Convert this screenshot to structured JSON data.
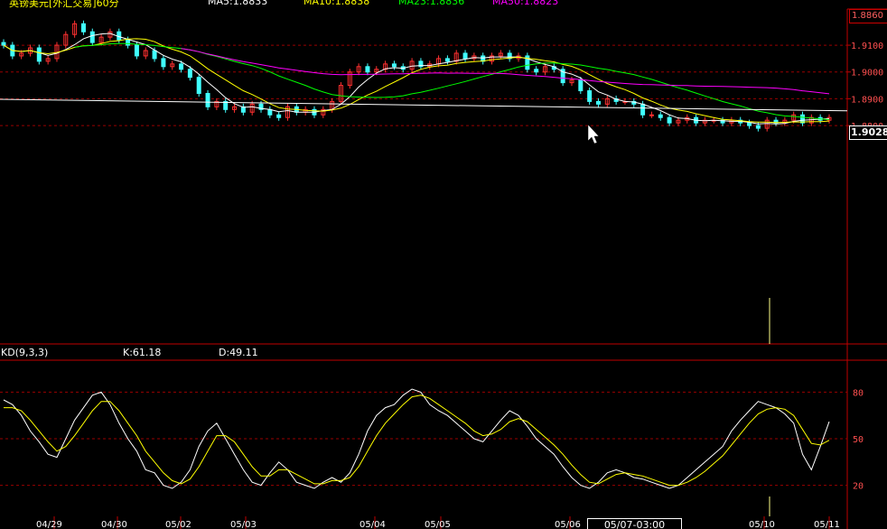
{
  "header": {
    "symbol_title": "英镑美元[外汇交易]60分",
    "ma5": "MA5:1.8833",
    "ma10": "MA10:1.8838",
    "ma23": "MA23:1.8836",
    "ma50": "MA50:1.8823"
  },
  "colors": {
    "background": "#000000",
    "up_candle": "#ff3030",
    "down_candle": "#40ffff",
    "ma5": "#ffffff",
    "ma10": "#ffff00",
    "ma23": "#00ff00",
    "ma50": "#ff00ff",
    "trendline": "#ffffff",
    "grid": "#990000"
  },
  "price_panel": {
    "top_value": "1.8860",
    "cursor_value": "1.9028",
    "y_ticks": [
      "1.9100",
      "1.9000",
      "1.8900",
      "1.8800"
    ]
  },
  "kd_panel": {
    "label": "KD(9,3,3)",
    "k_text": "K:61.18",
    "d_text": "D:49.11",
    "y_ticks": [
      "80",
      "50",
      "20"
    ]
  },
  "crosshair_date": "05/07-03:00",
  "x_labels": [
    "04/29",
    "04/30",
    "05/02",
    "05/03",
    "05/04",
    "05/05",
    "05/06",
    "05/10",
    "05/11"
  ],
  "chart_data": [
    {
      "type": "candlestick",
      "title": "英镑美元[外汇交易]60分",
      "ylim": [
        1.7985,
        1.9235
      ],
      "y_ticks": [
        1.91,
        1.9,
        1.89,
        1.88
      ],
      "series": [
        {
          "name": "MA5",
          "value": 1.8833
        },
        {
          "name": "MA10",
          "value": 1.8838
        },
        {
          "name": "MA23",
          "value": 1.8836
        },
        {
          "name": "MA50",
          "value": 1.8823
        }
      ],
      "close": [
        1.91,
        1.906,
        1.907,
        1.909,
        1.904,
        1.905,
        1.91,
        1.914,
        1.918,
        1.915,
        1.911,
        1.913,
        1.915,
        1.912,
        1.91,
        1.906,
        1.908,
        1.905,
        1.902,
        1.903,
        1.901,
        1.898,
        1.892,
        1.887,
        1.889,
        1.886,
        1.887,
        1.885,
        1.888,
        1.886,
        1.884,
        1.883,
        1.887,
        1.885,
        1.886,
        1.884,
        1.886,
        1.889,
        1.895,
        1.9,
        1.902,
        1.9,
        1.901,
        1.903,
        1.902,
        1.901,
        1.904,
        1.902,
        1.903,
        1.905,
        1.904,
        1.907,
        1.905,
        1.906,
        1.904,
        1.906,
        1.907,
        1.905,
        1.906,
        1.901,
        1.9,
        1.902,
        1.901,
        1.896,
        1.897,
        1.893,
        1.889,
        1.888,
        1.89,
        1.889,
        1.889,
        1.888,
        1.884,
        1.884,
        1.883,
        1.881,
        1.882,
        1.883,
        1.881,
        1.882,
        1.882,
        1.881,
        1.882,
        1.881,
        1.88,
        1.879,
        1.882,
        1.881,
        1.882,
        1.884,
        1.881,
        1.883,
        1.882,
        1.883
      ],
      "note_trendline": "white descending trendline from ~1.8898 to ~1.8855"
    },
    {
      "type": "line",
      "title": "KD(9,3,3)",
      "ylim": [
        0,
        100
      ],
      "y_ticks": [
        80,
        50,
        20
      ],
      "series": [
        {
          "name": "K",
          "value": 61.18,
          "values": [
            75,
            72,
            65,
            55,
            48,
            40,
            38,
            50,
            62,
            70,
            78,
            80,
            72,
            60,
            50,
            42,
            30,
            28,
            20,
            18,
            22,
            30,
            45,
            55,
            60,
            50,
            40,
            30,
            22,
            20,
            28,
            35,
            30,
            22,
            20,
            18,
            22,
            25,
            22,
            28,
            40,
            55,
            65,
            70,
            72,
            78,
            82,
            80,
            72,
            68,
            65,
            60,
            55,
            50,
            48,
            55,
            62,
            68,
            65,
            58,
            50,
            45,
            40,
            32,
            25,
            20,
            18,
            22,
            28,
            30,
            28,
            25,
            24,
            22,
            20,
            18,
            20,
            25,
            30,
            35,
            40,
            45,
            55,
            62,
            68,
            74,
            72,
            70,
            66,
            60,
            40,
            30,
            45,
            61
          ]
        },
        {
          "name": "D",
          "value": 49.11,
          "values": [
            70,
            70,
            68,
            62,
            55,
            48,
            42,
            45,
            52,
            60,
            68,
            74,
            74,
            68,
            60,
            52,
            42,
            35,
            28,
            23,
            21,
            24,
            32,
            42,
            52,
            52,
            48,
            40,
            32,
            26,
            26,
            30,
            30,
            27,
            24,
            21,
            21,
            23,
            23,
            25,
            32,
            42,
            52,
            60,
            66,
            72,
            77,
            78,
            76,
            72,
            68,
            64,
            60,
            55,
            52,
            53,
            56,
            61,
            63,
            61,
            56,
            51,
            46,
            40,
            33,
            27,
            22,
            21,
            24,
            27,
            28,
            27,
            26,
            24,
            22,
            20,
            20,
            22,
            25,
            29,
            34,
            39,
            46,
            53,
            60,
            66,
            69,
            70,
            69,
            65,
            56,
            47,
            46,
            49
          ]
        }
      ]
    }
  ]
}
